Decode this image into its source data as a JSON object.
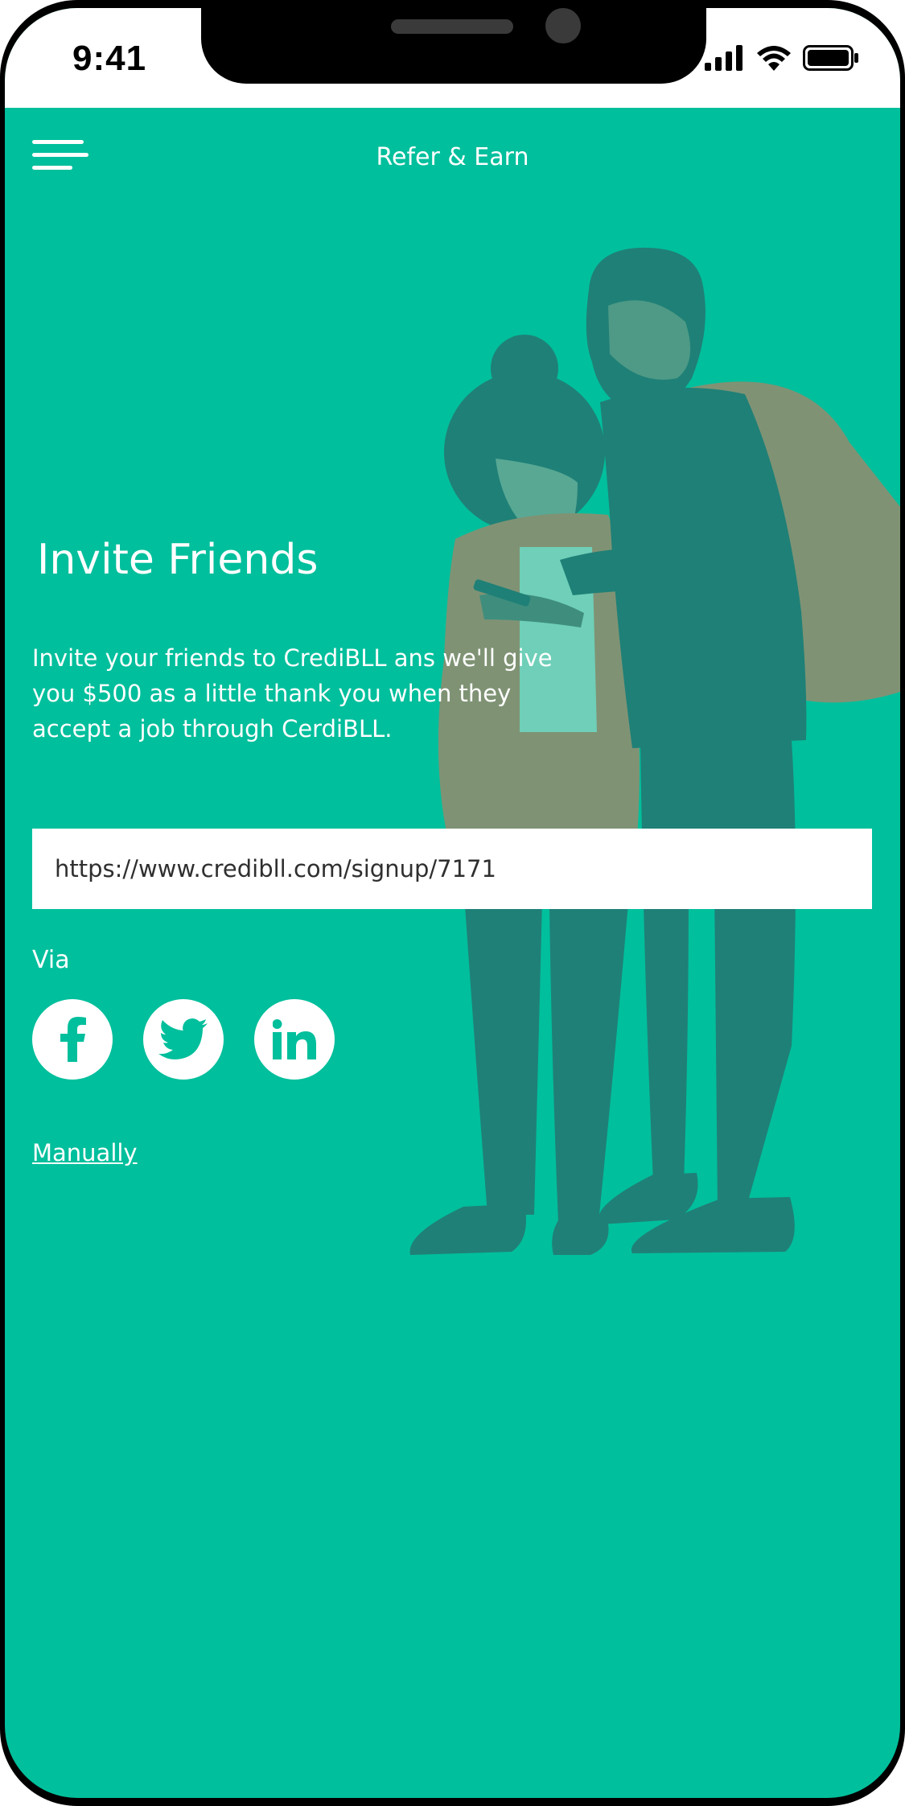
{
  "status_bar": {
    "time": "9:41",
    "icons": [
      "signal-icon",
      "wifi-icon",
      "battery-icon"
    ]
  },
  "header": {
    "title": "Refer & Earn",
    "menu_icon": "menu-icon"
  },
  "invite": {
    "title": "Invite Friends",
    "description": "Invite your friends to CrediBLL ans we'll give you $500 as a little thank you when they accept a job through CerdiBLL.",
    "link": "https://www.credibll.com/signup/7171"
  },
  "share": {
    "via_label": "Via",
    "options": [
      {
        "icon": "facebook-icon"
      },
      {
        "icon": "twitter-icon"
      },
      {
        "icon": "linkedin-icon"
      }
    ],
    "manual_label": "Manually"
  },
  "colors": {
    "background": "#00bf9c",
    "figure": "#1f8077",
    "jacket": "#7f9374",
    "text": "#ffffff"
  }
}
